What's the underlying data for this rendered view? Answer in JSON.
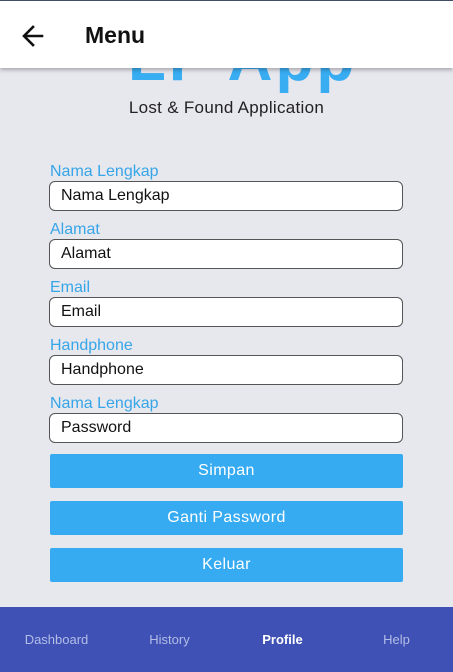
{
  "appbar": {
    "title": "Menu",
    "back_icon": "arrow-left-icon"
  },
  "logo": {
    "text": "LF App",
    "subtitle": "Lost & Found Application"
  },
  "form": {
    "fields": [
      {
        "label": "Nama Lengkap",
        "placeholder": "Nama Lengkap"
      },
      {
        "label": "Alamat",
        "placeholder": "Alamat"
      },
      {
        "label": "Email",
        "placeholder": "Email"
      },
      {
        "label": "Handphone",
        "placeholder": "Handphone"
      },
      {
        "label": "Nama Lengkap",
        "placeholder": "Password"
      }
    ]
  },
  "buttons": {
    "save": "Simpan",
    "change_password": "Ganti Password",
    "logout": "Keluar"
  },
  "bottom_nav": {
    "items": [
      {
        "label": "Dashboard"
      },
      {
        "label": "History"
      },
      {
        "label": "Profile"
      },
      {
        "label": "Help"
      }
    ],
    "active": "Profile"
  },
  "colors": {
    "accent": "#36abf2",
    "label": "#36a6e8",
    "nav_background": "#3f51b5",
    "page_background": "#e7e7ee"
  }
}
